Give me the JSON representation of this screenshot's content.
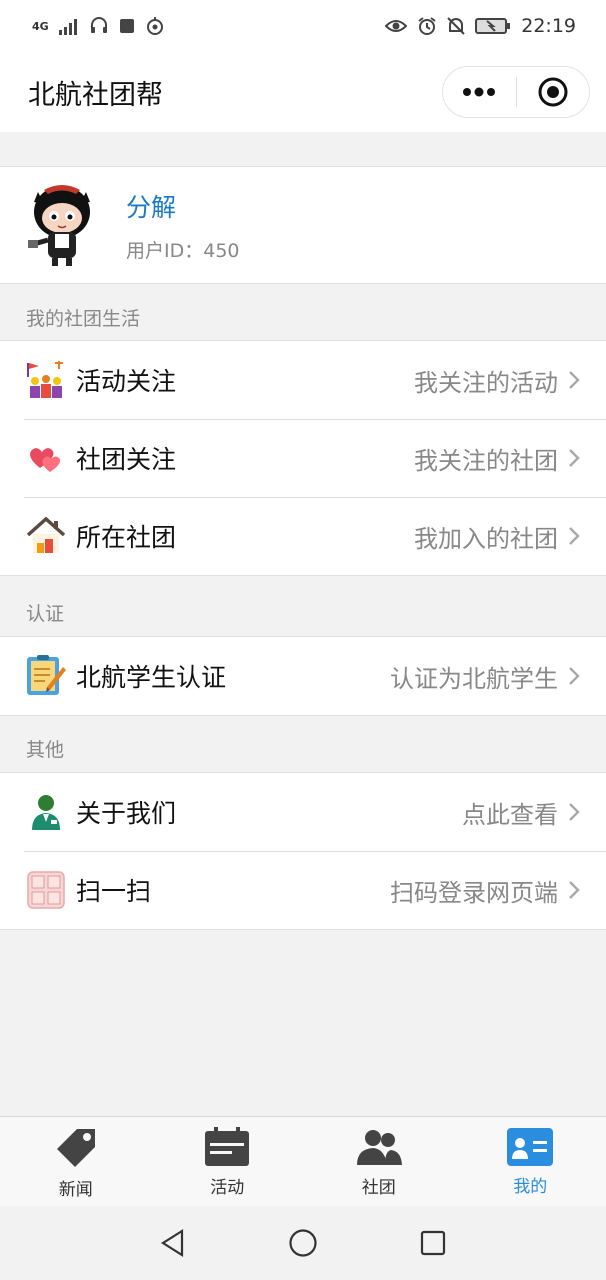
{
  "status_bar": {
    "network": "4G",
    "time": "22:19"
  },
  "nav": {
    "title": "北航社团帮",
    "more_icon": "more-dots-icon",
    "close_icon": "target-circle-icon"
  },
  "profile": {
    "name": "分解",
    "user_id": "用户ID：450",
    "avatar": "octocat-avatar"
  },
  "sections": [
    {
      "label": "我的社团生活",
      "items": [
        {
          "title": "活动关注",
          "desc": "我关注的活动",
          "icon": "activity-crowd-icon"
        },
        {
          "title": "社团关注",
          "desc": "我关注的社团",
          "icon": "hearts-icon"
        },
        {
          "title": "所在社团",
          "desc": "我加入的社团",
          "icon": "house-icon"
        }
      ]
    },
    {
      "label": "认证",
      "items": [
        {
          "title": "北航学生认证",
          "desc": "认证为北航学生",
          "icon": "clipboard-pencil-icon"
        }
      ]
    },
    {
      "label": "其他",
      "items": [
        {
          "title": "关于我们",
          "desc": "点此查看",
          "icon": "person-icon"
        },
        {
          "title": "扫一扫",
          "desc": "扫码登录网页端",
          "icon": "scan-grid-icon"
        }
      ]
    }
  ],
  "tabs": [
    {
      "label": "新闻",
      "icon": "tag-icon",
      "active": false
    },
    {
      "label": "活动",
      "icon": "calendar-icon",
      "active": false
    },
    {
      "label": "社团",
      "icon": "group-icon",
      "active": false
    },
    {
      "label": "我的",
      "icon": "contact-card-icon",
      "active": true
    }
  ],
  "colors": {
    "accent": "#2a8de0",
    "name_blue": "#1a7ac9",
    "muted_text": "#888888",
    "background": "#f2f2f3"
  }
}
